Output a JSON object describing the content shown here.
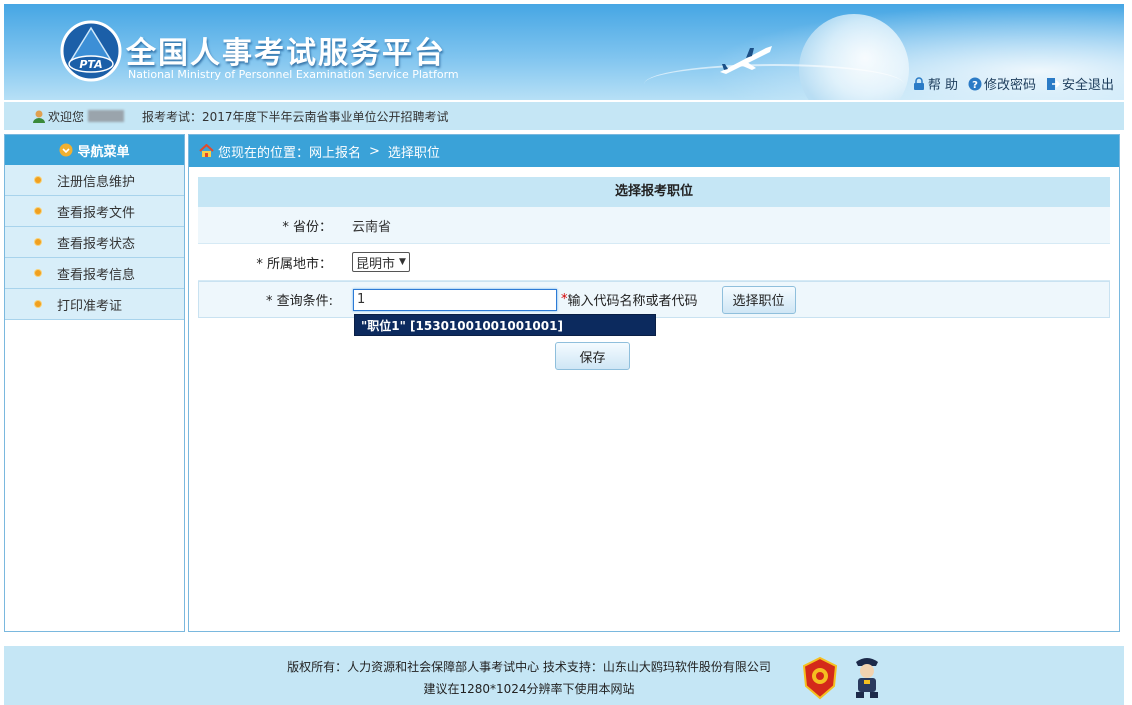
{
  "header": {
    "title": "全国人事考试服务平台",
    "subtitle": "National Ministry of Personnel Examination Service Platform",
    "emblem_text": "PTA",
    "links": [
      {
        "label": "帮 助",
        "icon": "lock-icon"
      },
      {
        "label": "修改密码",
        "icon": "question-icon"
      },
      {
        "label": "安全退出",
        "icon": "exit-icon"
      }
    ]
  },
  "welcome": {
    "greeting": "欢迎您",
    "exam_label": "报考考试：2017年度下半年云南省事业单位公开招聘考试"
  },
  "sidebar": {
    "header": "导航菜单",
    "items": [
      {
        "label": "注册信息维护"
      },
      {
        "label": "查看报考文件"
      },
      {
        "label": "查看报考状态"
      },
      {
        "label": "查看报考信息"
      },
      {
        "label": "打印准考证"
      }
    ]
  },
  "breadcrumb": {
    "prefix": "您现在的位置：网上报名",
    "separator": ">",
    "current": "选择职位"
  },
  "form": {
    "title": "选择报考职位",
    "province_label": "* 省份：",
    "province_value": "云南省",
    "city_label": "* 所属地市：",
    "city_value": "昆明市",
    "query_label": "* 查询条件:",
    "query_value": "1",
    "required_mark": "*",
    "query_hint": "输入代码名称或者代码",
    "select_button": "选择职位",
    "suggestion": "\"职位1\" [15301001001001001]",
    "save_button": "保存"
  },
  "footer": {
    "line1": "版权所有：人力资源和社会保障部人事考试中心  技术支持：山东山大鸥玛软件股份有限公司",
    "line2": "建议在1280*1024分辨率下使用本网站"
  },
  "colors": {
    "nav_blue": "#3aa2d8",
    "light_blue": "#c5e6f5",
    "suggest_bg": "#0c2a5e"
  }
}
